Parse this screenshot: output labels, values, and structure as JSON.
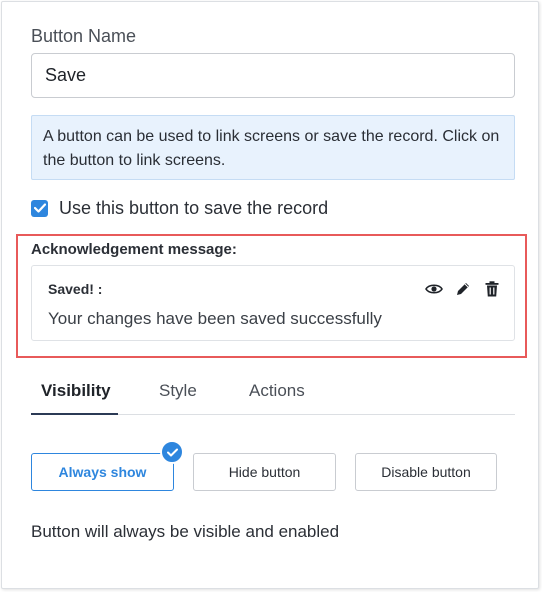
{
  "form": {
    "button_name_label": "Button Name",
    "button_name_value": "Save",
    "info_text": "A button can be used to link screens or save the record. Click on the button to link screens.",
    "save_record_checkbox_label": "Use this button to save the record",
    "save_record_checked": true
  },
  "acknowledgement": {
    "section_title": "Acknowledgement message:",
    "heading": "Saved! :",
    "message": "Your changes have been saved successfully",
    "icons": [
      "eye-icon",
      "pencil-icon",
      "trash-icon"
    ]
  },
  "tabs": [
    {
      "label": "Visibility",
      "active": true
    },
    {
      "label": "Style",
      "active": false
    },
    {
      "label": "Actions",
      "active": false
    }
  ],
  "visibility": {
    "options": [
      {
        "label": "Always show",
        "selected": true
      },
      {
        "label": "Hide button",
        "selected": false
      },
      {
        "label": "Disable button",
        "selected": false
      }
    ],
    "status_text": "Button will always be visible and enabled"
  },
  "colors": {
    "accent": "#2e86de",
    "highlight_border": "#e85a5a",
    "info_background": "#e8f2fd",
    "tab_underline": "#2b3a55"
  }
}
